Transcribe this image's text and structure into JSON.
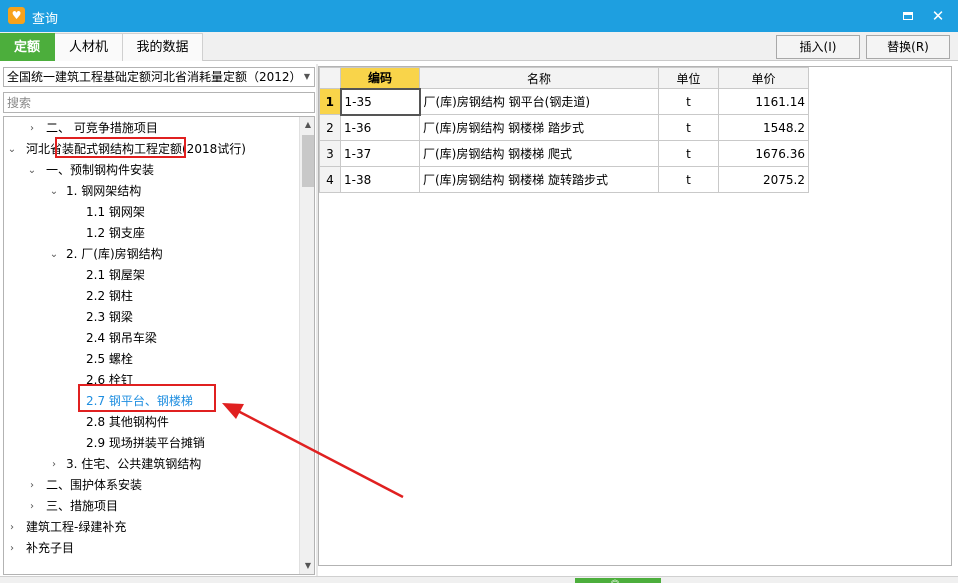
{
  "window": {
    "title": "查询",
    "app_icon_glyph": "♥",
    "minimize_label": "",
    "close_glyph": "✕"
  },
  "tabs": [
    {
      "label": "定额",
      "active": true
    },
    {
      "label": "人材机",
      "active": false
    },
    {
      "label": "我的数据",
      "active": false
    }
  ],
  "actions": {
    "insert_label": "插入(I)",
    "replace_label": "替换(R)"
  },
  "left": {
    "quota_library": "全国统一建筑工程基础定额河北省消耗量定额（2012）",
    "search_placeholder": "搜索",
    "tree": [
      {
        "label": "二、 可竞争措施项目",
        "level": 2,
        "toggle": "›"
      },
      {
        "label": "河北省装配式钢结构工程定额(2018试行)",
        "level": 0,
        "toggle": "⌄"
      },
      {
        "label": "一、预制钢构件安装",
        "level": 1,
        "toggle": "⌄"
      },
      {
        "label": "1. 钢网架结构",
        "level": 2,
        "toggle": "⌄"
      },
      {
        "label": "1.1 钢网架",
        "level": 3,
        "toggle": ""
      },
      {
        "label": "1.2 钢支座",
        "level": 3,
        "toggle": ""
      },
      {
        "label": "2. 厂(库)房钢结构",
        "level": 2,
        "toggle": "⌄"
      },
      {
        "label": "2.1 钢屋架",
        "level": 3,
        "toggle": ""
      },
      {
        "label": "2.2 钢柱",
        "level": 3,
        "toggle": ""
      },
      {
        "label": "2.3 钢梁",
        "level": 3,
        "toggle": ""
      },
      {
        "label": "2.4 钢吊车梁",
        "level": 3,
        "toggle": ""
      },
      {
        "label": "2.5 螺栓",
        "level": 3,
        "toggle": ""
      },
      {
        "label": "2.6 栓钉",
        "level": 3,
        "toggle": ""
      },
      {
        "label": "2.7 钢平台、钢楼梯",
        "level": 3,
        "toggle": "",
        "selected": true
      },
      {
        "label": "2.8 其他钢构件",
        "level": 3,
        "toggle": ""
      },
      {
        "label": "2.9 现场拼装平台摊销",
        "level": 3,
        "toggle": ""
      },
      {
        "label": "3. 住宅、公共建筑钢结构",
        "level": 2,
        "toggle": "›"
      },
      {
        "label": "二、围护体系安装",
        "level": 1,
        "toggle": "›"
      },
      {
        "label": "三、措施项目",
        "level": 1,
        "toggle": "›"
      },
      {
        "label": "建筑工程-绿建补充",
        "level": 0,
        "toggle": "›"
      },
      {
        "label": "补充子目",
        "level": 0,
        "toggle": "›"
      }
    ]
  },
  "grid": {
    "columns": [
      "编码",
      "名称",
      "单位",
      "单价"
    ],
    "rows": [
      {
        "num": "1",
        "code": "1-35",
        "name": "厂(库)房钢结构 钢平台(钢走道)",
        "unit": "t",
        "price": "1161.14"
      },
      {
        "num": "2",
        "code": "1-36",
        "name": "厂(库)房钢结构 钢楼梯 踏步式",
        "unit": "t",
        "price": "1548.2"
      },
      {
        "num": "3",
        "code": "1-37",
        "name": "厂(库)房钢结构 钢楼梯 爬式",
        "unit": "t",
        "price": "1676.36"
      },
      {
        "num": "4",
        "code": "1-38",
        "name": "厂(库)房钢结构 钢楼梯 旋转踏步式",
        "unit": "t",
        "price": "2075.2"
      }
    ]
  },
  "colors": {
    "titlebar": "#1e9fe0",
    "active_tab": "#4cae3c",
    "highlight": "#f9d44a",
    "annotation": "#e02020",
    "selected_text": "#1e8ee0"
  },
  "icons": {
    "app": "app-logo-icon",
    "minimize": "minimize-icon",
    "close": "close-icon",
    "dropdown": "chevron-down-icon",
    "expanded": "chevron-down-icon",
    "collapsed": "chevron-right-icon"
  }
}
